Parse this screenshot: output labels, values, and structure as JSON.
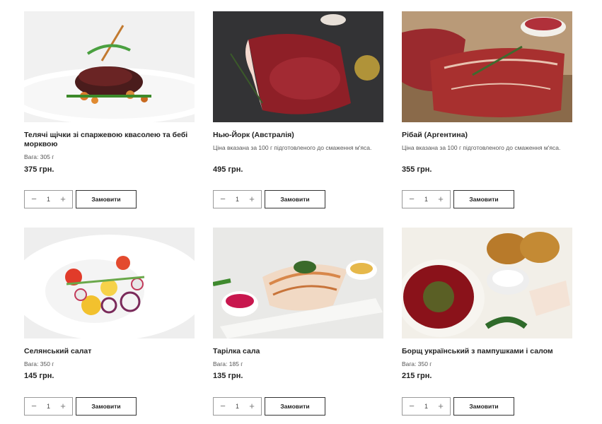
{
  "products": [
    {
      "name": "Телячі щічки зі спаржевою квасолею та бебі морквою",
      "desc": "Вага: 305 г",
      "price": "375 грн.",
      "qty": "1",
      "order_label": "Замовити",
      "image": "veal-cheeks-photo"
    },
    {
      "name": "Нью-Йорк (Австралія)",
      "desc": "Ціна вказана за 100 г підготовленого до смаження м'яса.",
      "price": "495 грн.",
      "qty": "1",
      "order_label": "Замовити",
      "image": "new-york-steak-photo"
    },
    {
      "name": "Рібай (Аргентина)",
      "desc": "Ціна вказана за 100 г підготовленого до смаження м'яса.",
      "price": "355 грн.",
      "qty": "1",
      "order_label": "Замовити",
      "image": "ribeye-steak-photo"
    },
    {
      "name": "Селянський салат",
      "desc": "Вага: 350 г",
      "price": "145 грн.",
      "qty": "1",
      "order_label": "Замовити",
      "image": "village-salad-photo"
    },
    {
      "name": "Тарілка сала",
      "desc": "Вага: 185 г",
      "price": "135 грн.",
      "qty": "1",
      "order_label": "Замовити",
      "image": "salo-plate-photo"
    },
    {
      "name": "Борщ український з пампушками і салом",
      "desc": "Вага: 350 г",
      "price": "215 грн.",
      "qty": "1",
      "order_label": "Замовити",
      "image": "borscht-photo"
    }
  ],
  "stepper": {
    "minus": "−",
    "plus": "+"
  }
}
